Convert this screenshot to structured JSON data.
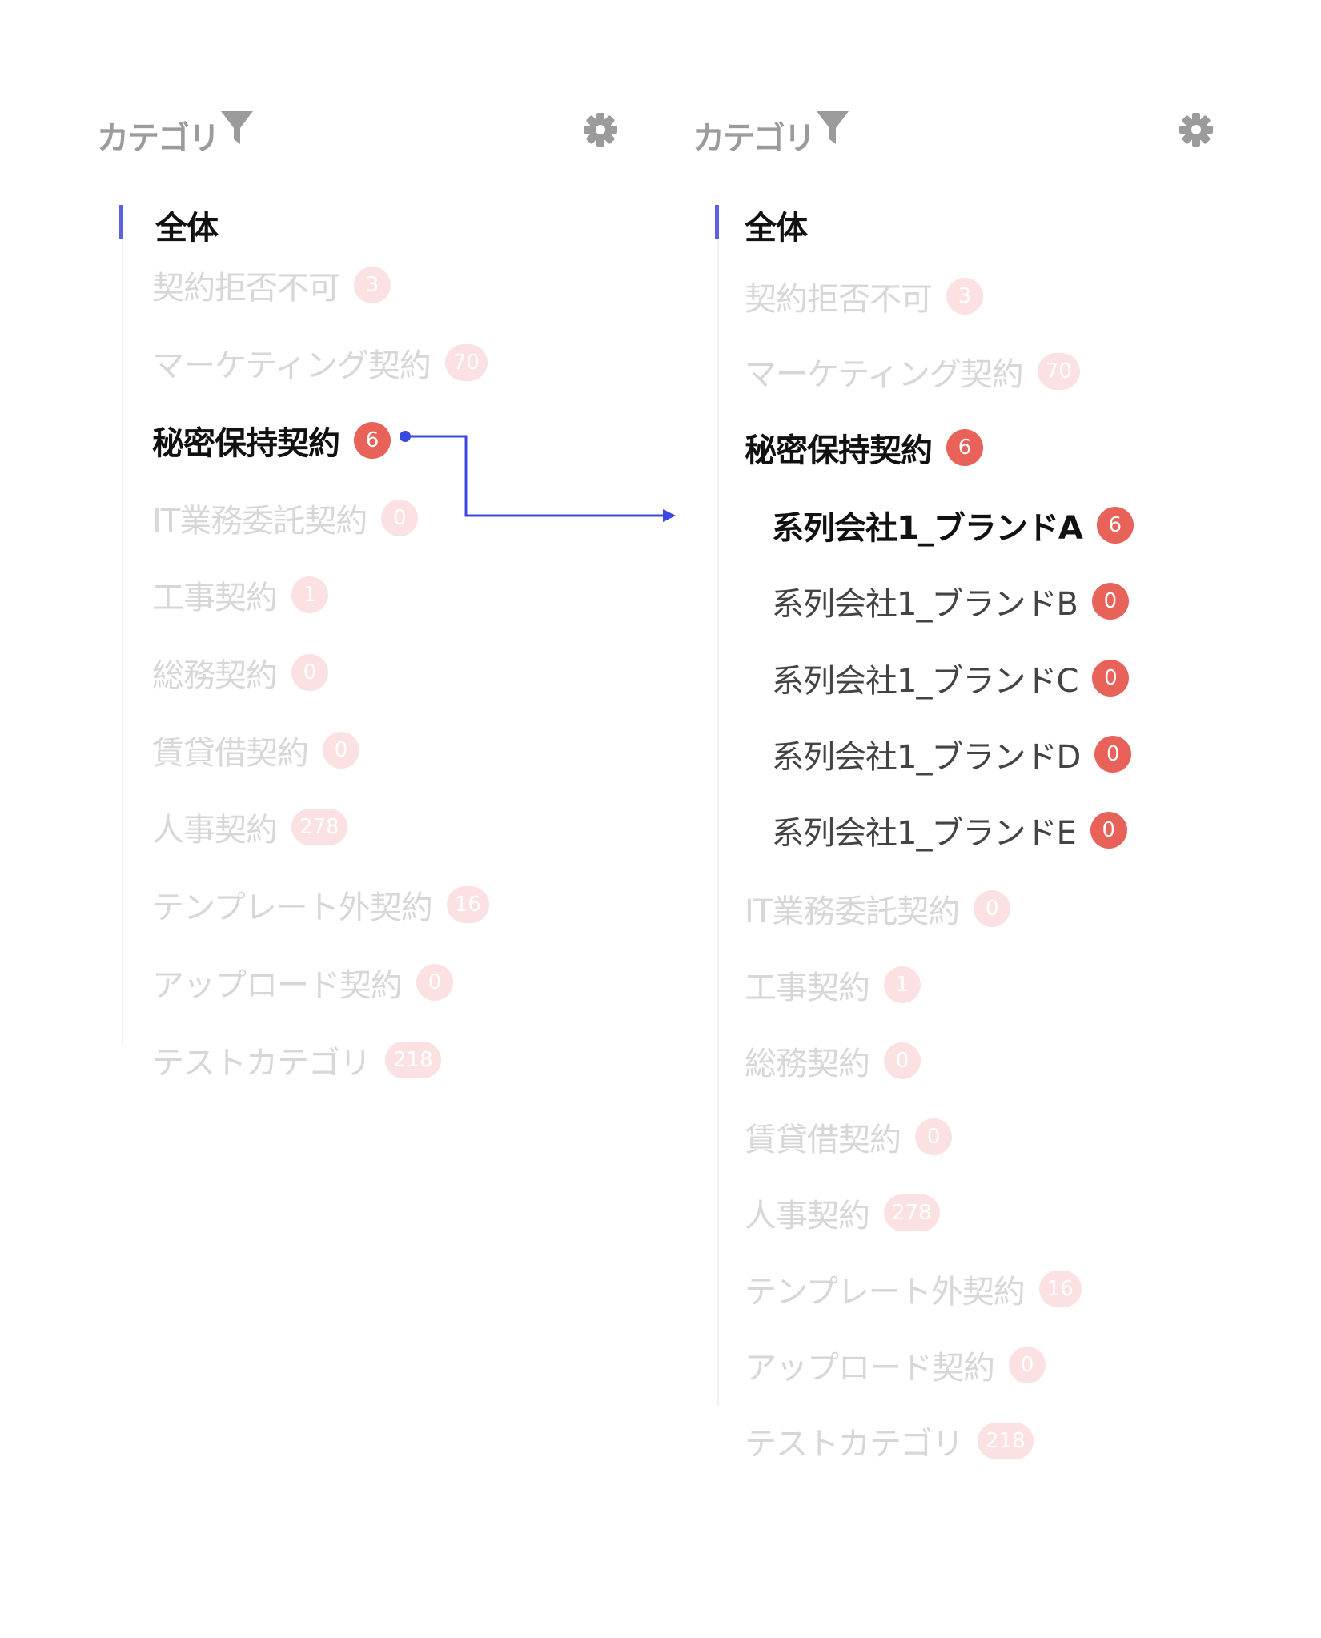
{
  "colors": {
    "accent": "#5b62e0",
    "badge_strong": "#e8625a",
    "badge_light": "#fbe1e1",
    "dim_text": "#d7d7d7",
    "header_text": "#9b9b9b"
  },
  "icons": {
    "filter": "filter-funnel-icon",
    "settings": "gear-icon"
  },
  "left_panel": {
    "header": {
      "title": "カテゴリ"
    },
    "all_label": "全体",
    "items": [
      {
        "label": "契約拒否不可",
        "count": "3",
        "state": "dim"
      },
      {
        "label": "マーケティング契約",
        "count": "70",
        "state": "dim"
      },
      {
        "label": "秘密保持契約",
        "count": "6",
        "state": "selected"
      },
      {
        "label": "IT業務委託契約",
        "count": "0",
        "state": "dim"
      },
      {
        "label": "工事契約",
        "count": "1",
        "state": "dim"
      },
      {
        "label": "総務契約",
        "count": "0",
        "state": "dim"
      },
      {
        "label": "賃貸借契約",
        "count": "0",
        "state": "dim"
      },
      {
        "label": "人事契約",
        "count": "278",
        "state": "dim"
      },
      {
        "label": "テンプレート外契約",
        "count": "16",
        "state": "dim"
      },
      {
        "label": "アップロード契約",
        "count": "0",
        "state": "dim"
      },
      {
        "label": "テストカテゴリ",
        "count": "218",
        "state": "dim"
      }
    ]
  },
  "right_panel": {
    "header": {
      "title": "カテゴリ"
    },
    "all_label": "全体",
    "items": [
      {
        "label": "契約拒否不可",
        "count": "3",
        "state": "dim"
      },
      {
        "label": "マーケティング契約",
        "count": "70",
        "state": "dim"
      },
      {
        "label": "秘密保持契約",
        "count": "6",
        "state": "selected"
      },
      {
        "label": "系列会社1_ブランドA",
        "count": "6",
        "state": "sub-selected"
      },
      {
        "label": "系列会社1_ブランドB",
        "count": "0",
        "state": "sub"
      },
      {
        "label": "系列会社1_ブランドC",
        "count": "0",
        "state": "sub"
      },
      {
        "label": "系列会社1_ブランドD",
        "count": "0",
        "state": "sub"
      },
      {
        "label": "系列会社1_ブランドE",
        "count": "0",
        "state": "sub"
      },
      {
        "label": "IT業務委託契約",
        "count": "0",
        "state": "dim"
      },
      {
        "label": "工事契約",
        "count": "1",
        "state": "dim"
      },
      {
        "label": "総務契約",
        "count": "0",
        "state": "dim"
      },
      {
        "label": "賃貸借契約",
        "count": "0",
        "state": "dim"
      },
      {
        "label": "人事契約",
        "count": "278",
        "state": "dim"
      },
      {
        "label": "テンプレート外契約",
        "count": "16",
        "state": "dim"
      },
      {
        "label": "アップロード契約",
        "count": "0",
        "state": "dim"
      },
      {
        "label": "テストカテゴリ",
        "count": "218",
        "state": "dim"
      }
    ]
  }
}
